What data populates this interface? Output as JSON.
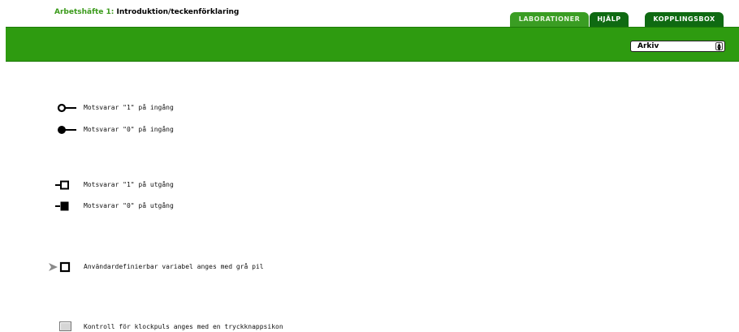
{
  "header": {
    "title_prefix": "Arbetshäfte 1:",
    "title": "Introduktion/teckenförklaring"
  },
  "tabs": [
    {
      "label": "LABORATIONER",
      "active": true
    },
    {
      "label": "HJÄLP",
      "active": false
    },
    {
      "label": "KOPPLINGSBOX",
      "active": false
    }
  ],
  "toolbar": {
    "archive_select": {
      "selected": "Arkiv"
    }
  },
  "legend": [
    {
      "icon": "input-one-icon",
      "text": "Motsvarar \"1\" på ingång"
    },
    {
      "icon": "input-zero-icon",
      "text": "Motsvarar \"0\" på ingång"
    },
    {
      "icon": "output-one-icon",
      "text": "Motsvarar \"1\" på utgång"
    },
    {
      "icon": "output-zero-icon",
      "text": "Motsvarar \"0\" på utgång"
    },
    {
      "icon": "gray-arrow-variable-icon",
      "text": "Användardefinierbar variabel anges med grå pil"
    },
    {
      "icon": "pushbutton-icon",
      "text": "Kontroll för klockpuls anges med en tryckknappsikon"
    }
  ],
  "colors": {
    "brand_green": "#2e9b10",
    "tab_dark": "#0f6a12",
    "tab_active": "#3a9d23"
  }
}
